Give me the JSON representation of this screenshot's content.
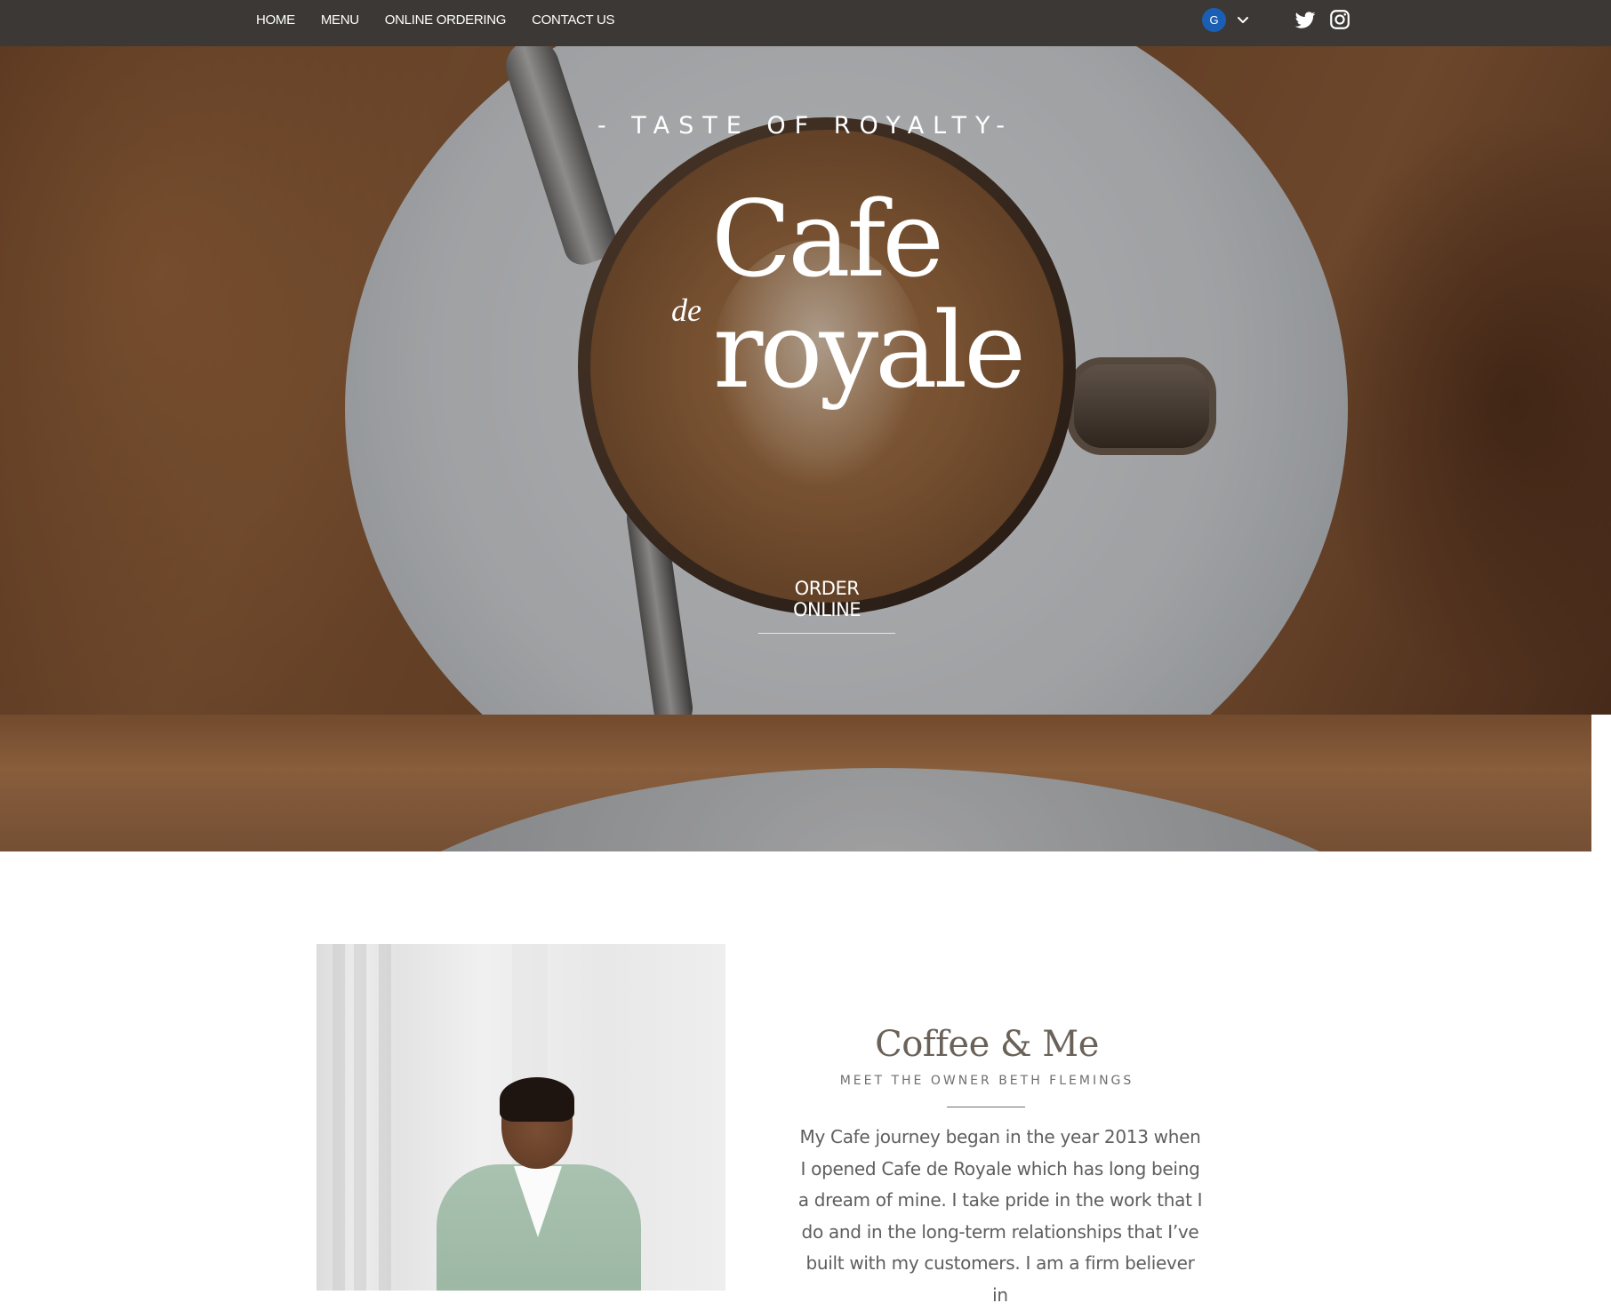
{
  "nav": {
    "links": [
      "HOME",
      "MENU",
      "ONLINE ORDERING",
      "CONTACT US"
    ],
    "language_badge": "G",
    "social": [
      "twitter-icon",
      "instagram-icon"
    ]
  },
  "hero": {
    "tagline": "- TASTE OF ROYALTY-",
    "logo": {
      "line1": "Cafe",
      "connector": "de",
      "line2": "royale"
    },
    "cta": "ORDER ONLINE"
  },
  "about": {
    "title": "Coffee & Me",
    "subtitle": "MEET THE OWNER BETH FLEMINGS",
    "body": "My Cafe journey began in the year 2013 when I opened Cafe de Royale which has long  being a dream of mine. I take pride in the work that I do and in the long-term relationships that I’ve built with my customers. I am a firm believer in"
  },
  "colors": {
    "nav_bg": "#3b3835",
    "accent_blue": "#1b5fb4",
    "heading_text": "#6a6259",
    "body_text": "#5e5e5e"
  }
}
